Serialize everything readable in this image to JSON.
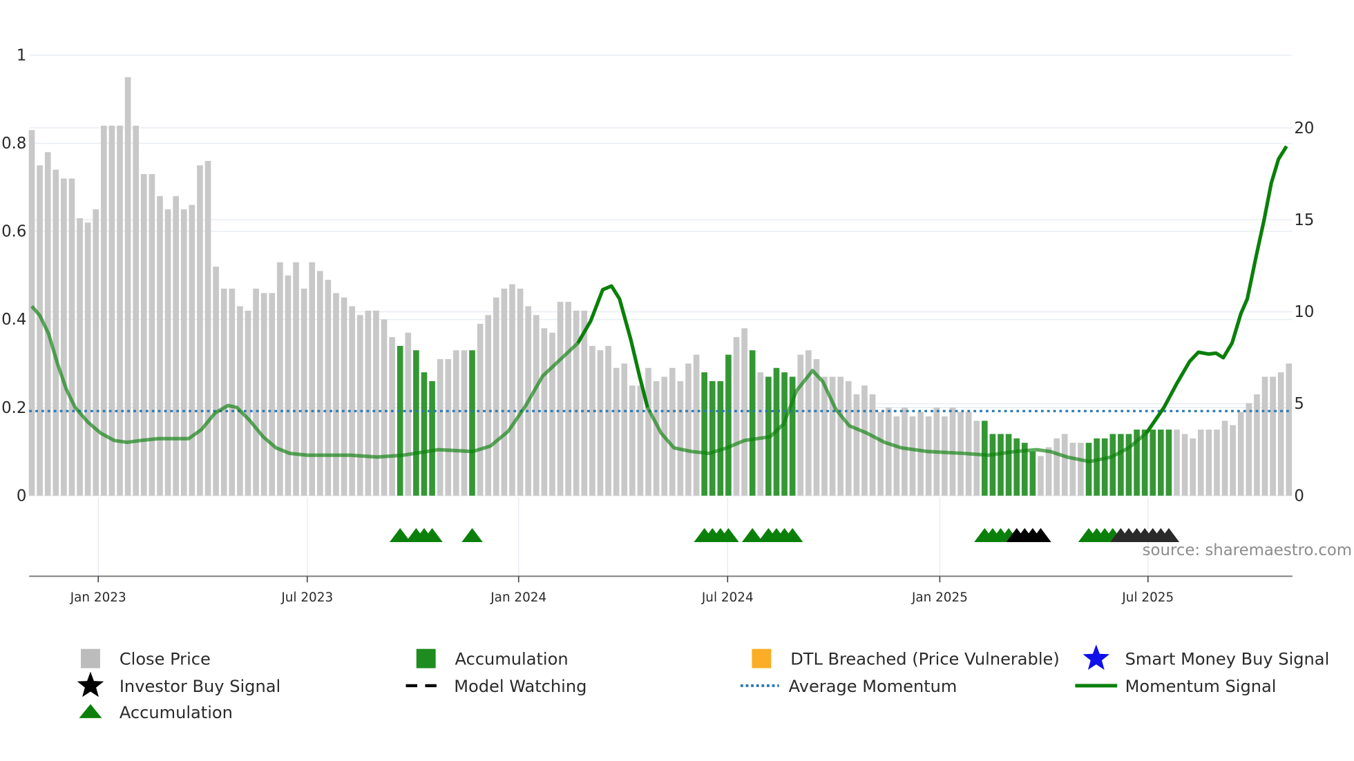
{
  "chart_data": {
    "type": "bar",
    "title": "",
    "source": "source: sharemaestro.com",
    "left_axis": {
      "ylim": [
        0,
        1
      ],
      "ticks": [
        0,
        0.2,
        0.4,
        0.6,
        0.8,
        1
      ],
      "tick_labels": [
        "0",
        "0.2",
        "0.4",
        "0.6",
        "0.8",
        "1"
      ]
    },
    "right_axis": {
      "ylim": [
        0,
        20
      ],
      "ticks": [
        0,
        5,
        10,
        15,
        20
      ],
      "tick_labels": [
        "0",
        "5",
        "10",
        "15",
        "20"
      ]
    },
    "x_axis": {
      "unit": "week index (weekly bars)",
      "tick_labels": [
        "Jan 2023",
        "Jul 2023",
        "Jan 2024",
        "Jul 2024",
        "Jan 2025",
        "Jul 2025"
      ],
      "tick_positions_week": [
        8.3,
        34.4,
        60.8,
        86.9,
        113.4,
        139.4
      ]
    },
    "close_price": [
      0.83,
      0.75,
      0.78,
      0.74,
      0.72,
      0.72,
      0.63,
      0.62,
      0.65,
      0.84,
      0.84,
      0.84,
      0.95,
      0.84,
      0.73,
      0.73,
      0.68,
      0.65,
      0.68,
      0.65,
      0.66,
      0.75,
      0.76,
      0.52,
      0.47,
      0.47,
      0.43,
      0.42,
      0.47,
      0.46,
      0.46,
      0.53,
      0.5,
      0.53,
      0.47,
      0.53,
      0.51,
      0.49,
      0.46,
      0.45,
      0.43,
      0.41,
      0.42,
      0.42,
      0.4,
      0.36,
      0.34,
      0.37,
      0.33,
      0.28,
      0.26,
      0.31,
      0.31,
      0.33,
      0.33,
      0.33,
      0.39,
      0.41,
      0.45,
      0.47,
      0.48,
      0.47,
      0.43,
      0.41,
      0.38,
      0.37,
      0.44,
      0.44,
      0.42,
      0.42,
      0.34,
      0.33,
      0.34,
      0.29,
      0.3,
      0.25,
      0.25,
      0.29,
      0.26,
      0.27,
      0.29,
      0.26,
      0.3,
      0.32,
      0.28,
      0.26,
      0.26,
      0.32,
      0.36,
      0.38,
      0.33,
      0.28,
      0.27,
      0.29,
      0.28,
      0.27,
      0.32,
      0.33,
      0.31,
      0.27,
      0.27,
      0.27,
      0.26,
      0.23,
      0.25,
      0.23,
      0.19,
      0.2,
      0.18,
      0.2,
      0.18,
      0.19,
      0.18,
      0.2,
      0.18,
      0.2,
      0.19,
      0.19,
      0.17,
      0.17,
      0.14,
      0.14,
      0.14,
      0.13,
      0.12,
      0.1,
      0.09,
      0.11,
      0.13,
      0.14,
      0.12,
      0.12,
      0.12,
      0.13,
      0.13,
      0.14,
      0.14,
      0.14,
      0.15,
      0.15,
      0.15,
      0.15,
      0.15,
      0.15,
      0.14,
      0.13,
      0.15,
      0.15,
      0.15,
      0.17,
      0.16,
      0.19,
      0.21,
      0.23,
      0.27,
      0.27,
      0.28,
      0.3
    ],
    "accumulation_weeks": [
      46,
      48,
      49,
      50,
      55,
      84,
      85,
      86,
      87,
      90,
      92,
      93,
      94,
      95,
      119,
      120,
      121,
      122,
      123,
      124,
      125,
      132,
      133,
      134,
      135,
      136,
      137,
      138,
      139,
      140,
      141,
      142
    ],
    "accumulation_triangles": [
      46,
      48,
      49,
      50,
      55,
      84,
      85,
      86,
      87,
      90,
      92,
      93,
      94,
      95,
      119,
      120,
      121,
      122,
      132,
      133,
      134,
      135
    ],
    "investor_buy_triangles": [
      123,
      124,
      125,
      126,
      136,
      137,
      138,
      139,
      140,
      141,
      142
    ],
    "average_momentum": 4.6,
    "momentum_signal": [
      [
        0,
        10.3
      ],
      [
        1,
        9.8
      ],
      [
        2.1,
        8.8
      ],
      [
        3.2,
        7.2
      ],
      [
        4.3,
        5.8
      ],
      [
        5.4,
        4.8
      ],
      [
        7,
        4.0
      ],
      [
        8.6,
        3.4
      ],
      [
        10.3,
        3.0
      ],
      [
        11.9,
        2.9
      ],
      [
        13.6,
        3.0
      ],
      [
        15.8,
        3.1
      ],
      [
        17.9,
        3.1
      ],
      [
        19.6,
        3.1
      ],
      [
        21.2,
        3.6
      ],
      [
        22.9,
        4.5
      ],
      [
        24.5,
        4.9
      ],
      [
        25.6,
        4.8
      ],
      [
        27.2,
        4.1
      ],
      [
        28.9,
        3.2
      ],
      [
        30.5,
        2.6
      ],
      [
        32.2,
        2.3
      ],
      [
        34.4,
        2.2
      ],
      [
        39.8,
        2.2
      ],
      [
        43.1,
        2.1
      ],
      [
        46.4,
        2.2
      ],
      [
        50.8,
        2.5
      ],
      [
        55.1,
        2.4
      ],
      [
        57.3,
        2.7
      ],
      [
        59.5,
        3.5
      ],
      [
        61.7,
        4.9
      ],
      [
        63.8,
        6.5
      ],
      [
        66,
        7.4
      ],
      [
        68.2,
        8.3
      ],
      [
        69.8,
        9.5
      ],
      [
        71.3,
        11.2
      ],
      [
        72.4,
        11.4
      ],
      [
        73.4,
        10.7
      ],
      [
        74.8,
        8.5
      ],
      [
        75.9,
        6.5
      ],
      [
        76.9,
        4.8
      ],
      [
        78.6,
        3.4
      ],
      [
        80.2,
        2.6
      ],
      [
        82.4,
        2.4
      ],
      [
        84.6,
        2.3
      ],
      [
        86.8,
        2.6
      ],
      [
        89,
        3.0
      ],
      [
        92.2,
        3.2
      ],
      [
        93.9,
        3.9
      ],
      [
        95.5,
        5.7
      ],
      [
        97.5,
        6.8
      ],
      [
        98.8,
        6.2
      ],
      [
        100.4,
        4.7
      ],
      [
        102.1,
        3.8
      ],
      [
        104.3,
        3.4
      ],
      [
        106.5,
        2.9
      ],
      [
        108.6,
        2.6
      ],
      [
        111.9,
        2.4
      ],
      [
        116.3,
        2.3
      ],
      [
        119.5,
        2.2
      ],
      [
        122.8,
        2.4
      ],
      [
        125.5,
        2.5
      ],
      [
        127.2,
        2.4
      ],
      [
        129.3,
        2.1
      ],
      [
        132.1,
        1.85
      ],
      [
        134.8,
        2.1
      ],
      [
        137,
        2.6
      ],
      [
        139.2,
        3.4
      ],
      [
        141.4,
        4.8
      ],
      [
        143,
        6.1
      ],
      [
        144.6,
        7.3
      ],
      [
        145.7,
        7.8
      ],
      [
        147,
        7.7
      ],
      [
        147.9,
        7.75
      ],
      [
        148.8,
        7.5
      ],
      [
        149.9,
        8.3
      ],
      [
        151,
        9.9
      ],
      [
        151.8,
        10.7
      ],
      [
        152.9,
        13.0
      ],
      [
        153.9,
        15.0
      ],
      [
        154.8,
        17.0
      ],
      [
        155.7,
        18.3
      ],
      [
        156.7,
        19.0
      ]
    ],
    "legend": {
      "placement": "bottom",
      "items": [
        {
          "label": "Close Price",
          "symbol": "square",
          "color": "#bcbcbc"
        },
        {
          "label": "Accumulation",
          "symbol": "square",
          "color": "#1e8c1e"
        },
        {
          "label": "DTL Breached (Price Vulnerable)",
          "symbol": "square",
          "color": "#fbae25"
        },
        {
          "label": "Smart Money Buy Signal",
          "symbol": "star",
          "color": "#1010e8"
        },
        {
          "label": "Investor Buy Signal",
          "symbol": "star",
          "color": "#000000"
        },
        {
          "label": "Model Watching",
          "symbol": "dash",
          "color": "#000000"
        },
        {
          "label": "Average Momentum",
          "symbol": "dot",
          "color": "#2a78b4"
        },
        {
          "label": "Momentum Signal",
          "symbol": "line",
          "color": "#0a800a"
        },
        {
          "label": "Accumulation",
          "symbol": "triangle",
          "color": "#0a800a"
        }
      ]
    },
    "colors": {
      "bar": "#c8c8c8",
      "accum_bar": "#1e8c1e",
      "momentum": "#0a800a",
      "avg": "#2a78b4",
      "grid": "#e8edf3",
      "investor": "#000000",
      "investor_dark": "#2a2a2a"
    }
  }
}
